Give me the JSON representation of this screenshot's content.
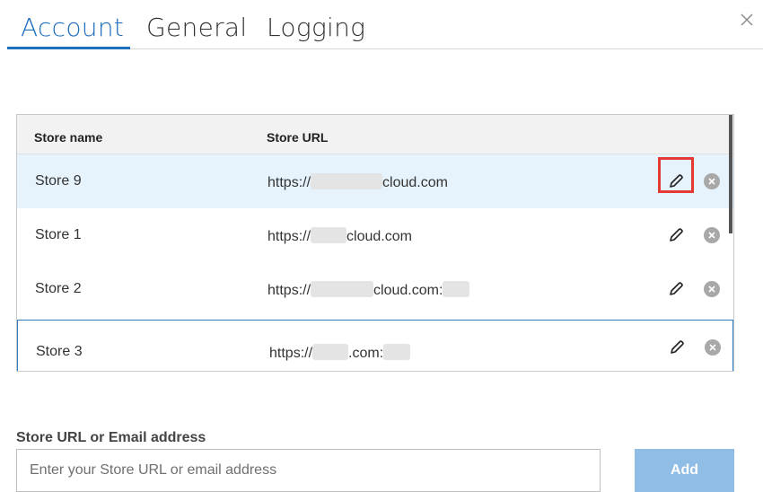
{
  "tabs": [
    {
      "label": "Account",
      "active": true
    },
    {
      "label": "General",
      "active": false
    },
    {
      "label": "Logging",
      "active": false
    }
  ],
  "close_icon": "close-icon",
  "table": {
    "headers": {
      "name": "Store name",
      "url": "Store URL"
    },
    "rows": [
      {
        "name": "Store 9",
        "url_prefix": "https://",
        "url_suffix": "cloud.com",
        "url_port": "",
        "selected": true,
        "highlighted_action": "edit"
      },
      {
        "name": "Store 1",
        "url_prefix": "https://",
        "url_suffix": "cloud.com",
        "url_port": "",
        "selected": false
      },
      {
        "name": "Store 2",
        "url_prefix": "https://",
        "url_suffix": "cloud.com:",
        "url_port": "",
        "selected": false
      },
      {
        "name": "Store 3",
        "url_prefix": "https://",
        "url_suffix": ".com:",
        "url_port": "",
        "selected": false,
        "focused": true
      }
    ],
    "row_actions": {
      "edit_icon": "pencil-icon",
      "remove_icon": "remove-circle-icon"
    }
  },
  "add_store": {
    "label": "Store URL or Email address",
    "placeholder": "Enter your Store URL or email address",
    "value": "",
    "button_label": "Add"
  },
  "colors": {
    "accent": "#1f6fbf",
    "selected_row": "#e6f3fc",
    "highlight": "#e53935",
    "add_button": "#8fbde6"
  }
}
